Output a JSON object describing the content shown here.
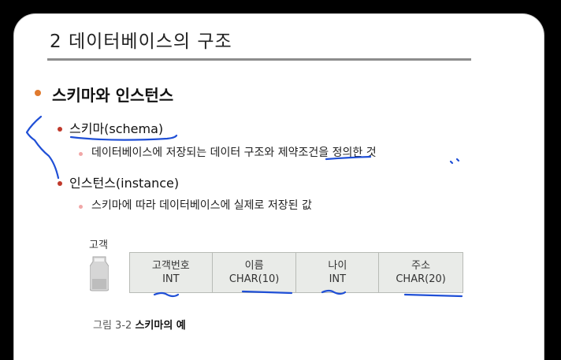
{
  "slide": {
    "title": "2 데이터베이스의 구조",
    "heading": "스키마와 인스턴스",
    "items": [
      {
        "label": "스키마(schema)",
        "sub": "데이터베이스에 저장되는 데이터 구조와 제약조건을 정의한 것"
      },
      {
        "label": "인스턴스(instance)",
        "sub": "스키마에 따라 데이터베이스에 실제로 저장된 값"
      }
    ]
  },
  "figure": {
    "table_name": "고객",
    "columns": [
      {
        "name": "고객번호",
        "type": "INT"
      },
      {
        "name": "이름",
        "type": "CHAR(10)"
      },
      {
        "name": "나이",
        "type": "INT"
      },
      {
        "name": "주소",
        "type": "CHAR(20)"
      }
    ],
    "caption_number": "그림 3-2",
    "caption_text": "스키마의 예"
  },
  "colors": {
    "accent_bullet": "#e07a2e",
    "ink": "#1f4fd6"
  }
}
